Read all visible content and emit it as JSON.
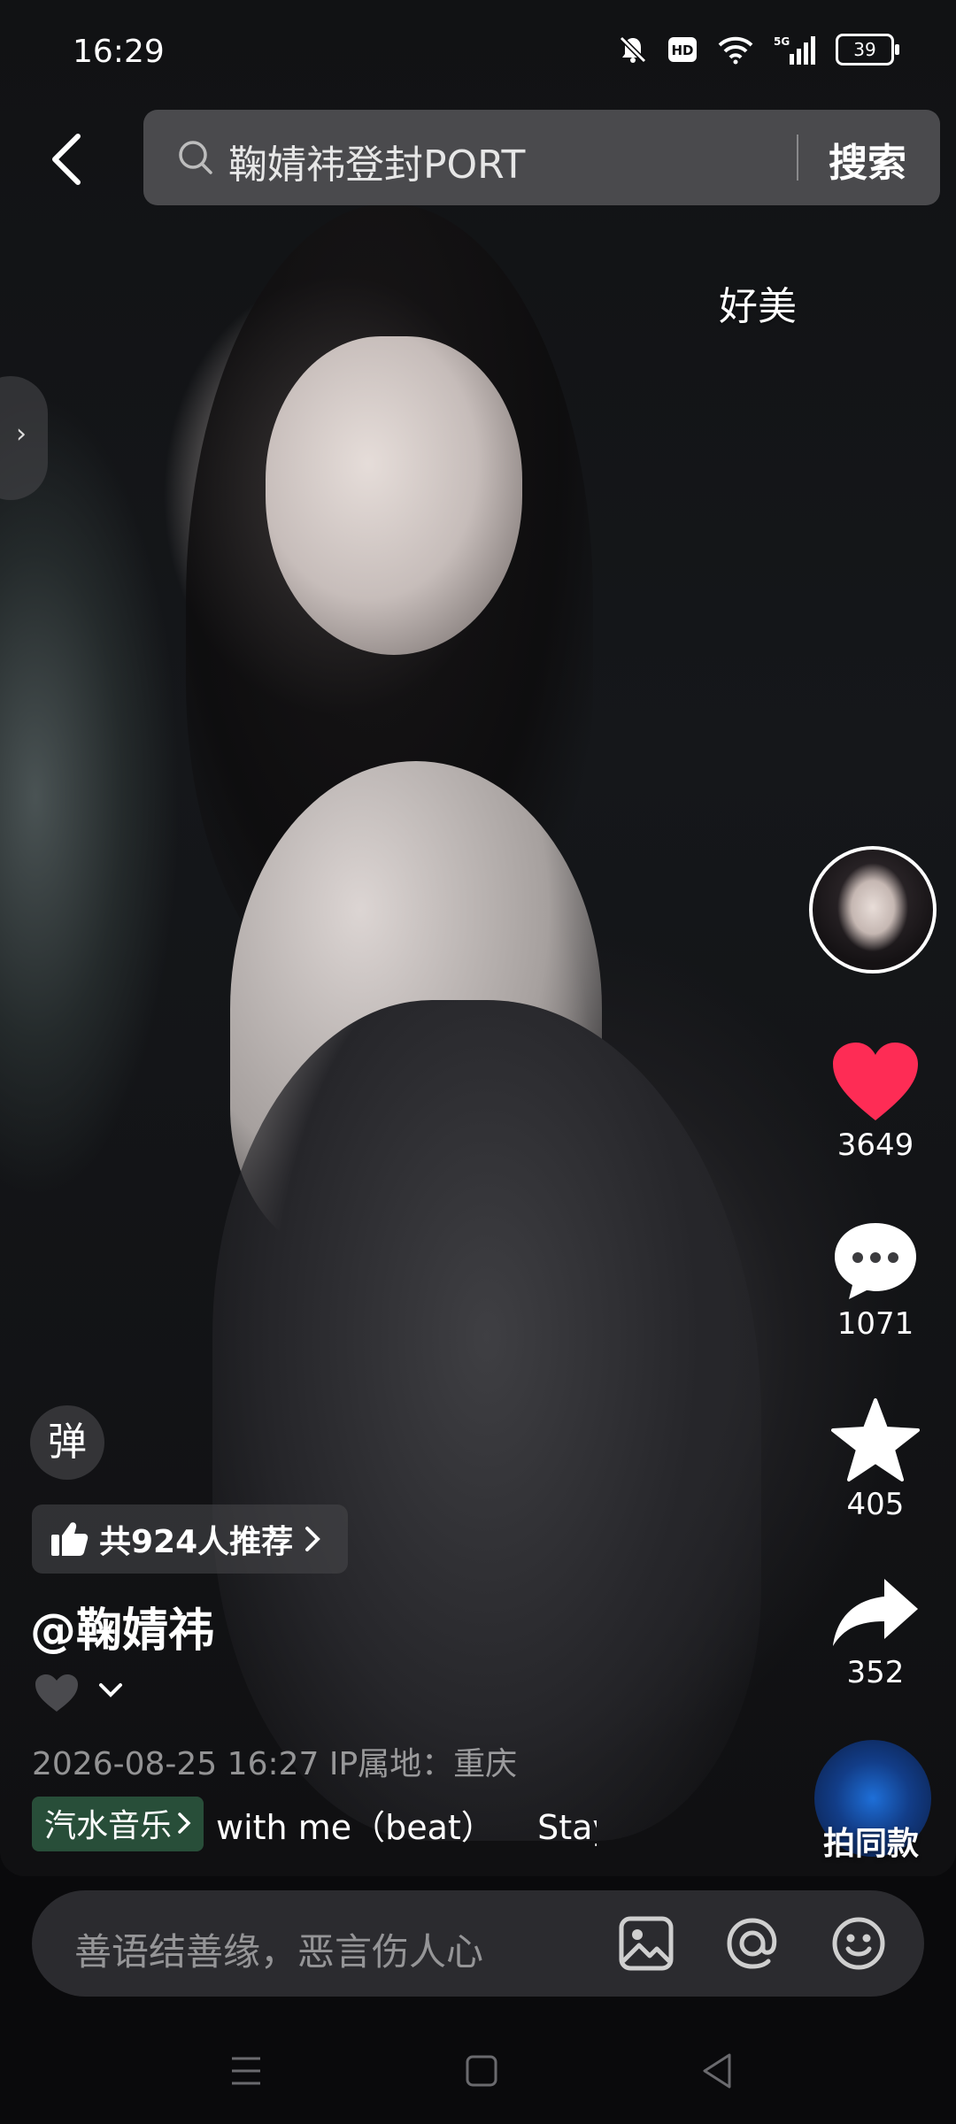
{
  "status_bar": {
    "time": "16:29",
    "network": "5G",
    "battery": "39"
  },
  "header": {
    "search_query": "鞠婧祎登封PORT",
    "search_button": "搜索"
  },
  "overlay": {
    "danmaku_comment": "好美"
  },
  "actions": {
    "like_count": "3649",
    "comment_count": "1071",
    "favorite_count": "405",
    "share_count": "352",
    "shoot_same": "拍同款"
  },
  "info": {
    "danmaku_toggle": "弹",
    "recommend": "共924人推荐",
    "username": "@鞠婧祎",
    "meta": "2026-08-25 16:27  IP属地：重庆",
    "music_tag": "汽水音乐",
    "music_title": "with me（beat）    Stay"
  },
  "comment_bar": {
    "placeholder": "善语结善缘，恶言伤人心"
  },
  "colors": {
    "like_red": "#fe2c55",
    "accent_white": "#ffffff",
    "music_tag_bg": "#3c825a"
  },
  "icons": [
    "back-arrow-icon",
    "search-icon",
    "heart-icon",
    "comment-icon",
    "star-icon",
    "share-icon",
    "image-icon",
    "at-icon",
    "emoji-icon"
  ]
}
